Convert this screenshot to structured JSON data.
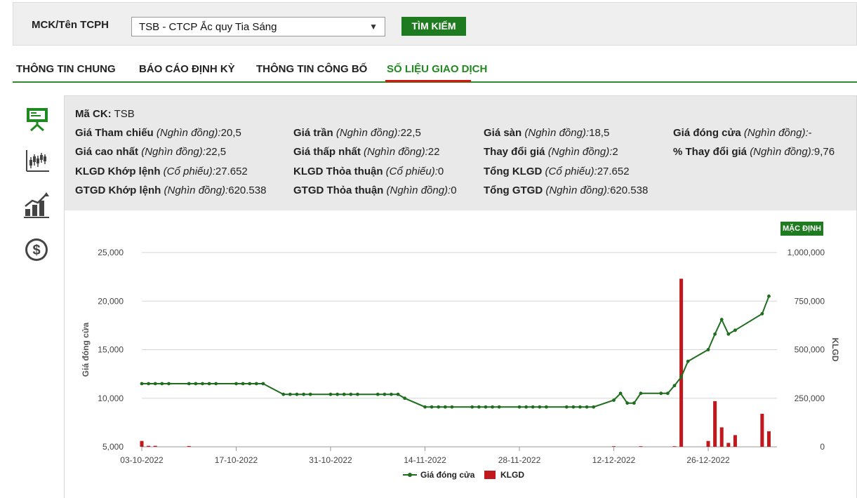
{
  "search": {
    "label": "MCK/Tên TCPH",
    "selected": "TSB - CTCP Ắc quy Tia Sáng",
    "button_label": "TÌM KIẾM"
  },
  "tabs": [
    {
      "label": "THÔNG TIN CHUNG",
      "active": false
    },
    {
      "label": "BÁO CÁO ĐỊNH KỲ",
      "active": false
    },
    {
      "label": "THÔNG TIN CÔNG BỐ",
      "active": false
    },
    {
      "label": "SỐ LIỆU GIAO DỊCH",
      "active": true
    }
  ],
  "side_icons": [
    "presentation-board-icon",
    "candlestick-chart-icon",
    "bar-growth-chart-icon",
    "dollar-coin-icon"
  ],
  "info": {
    "ticker_label": "Mã CK:",
    "ticker": "TSB",
    "rows": [
      [
        {
          "label": "Giá Tham chiếu",
          "unit": "(Nghìn đồng):",
          "value": "20,5"
        },
        {
          "label": "Giá trần",
          "unit": "(Nghìn đồng):",
          "value": "22,5"
        },
        {
          "label": "Giá sàn",
          "unit": "(Nghìn đồng):",
          "value": "18,5"
        },
        {
          "label": "Giá đóng cửa",
          "unit": "(Nghìn đồng):",
          "value": "-"
        }
      ],
      [
        {
          "label": "Giá cao nhất",
          "unit": "(Nghìn đồng):",
          "value": "22,5"
        },
        {
          "label": "Giá thấp nhất",
          "unit": "(Nghìn đồng):",
          "value": "22"
        },
        {
          "label": "Thay đổi giá",
          "unit": "(Nghìn đồng):",
          "value": "2"
        },
        {
          "label": "% Thay đổi giá",
          "unit": "(Nghìn đồng):",
          "value": "9,76"
        }
      ],
      [
        {
          "label": "KLGD Khớp lệnh",
          "unit": "(Cổ phiếu):",
          "value": "27.652"
        },
        {
          "label": "KLGD Thỏa thuận",
          "unit": "(Cổ phiếu):",
          "value": "0"
        },
        {
          "label": "Tổng KLGD",
          "unit": "(Cổ phiếu):",
          "value": "27.652"
        }
      ],
      [
        {
          "label": "GTGD Khớp lệnh",
          "unit": "(Nghìn đồng):",
          "value": "620.538"
        },
        {
          "label": "GTGD Thỏa thuận",
          "unit": "(Nghìn đồng):",
          "value": "0"
        },
        {
          "label": "Tổng GTGD",
          "unit": "(Nghìn đồng):",
          "value": "620.538"
        }
      ]
    ]
  },
  "chart_button": "MẶC ĐỊNH",
  "colors": {
    "line": "#1f6e1f",
    "bar": "#c0181c",
    "accent": "#1f7b1f"
  },
  "chart_data": {
    "type": "line",
    "xlabel": "",
    "ylabel": "Giá đóng cửa",
    "y2label": "KLGD",
    "ylim": [
      5000,
      25000
    ],
    "y2lim": [
      0,
      1000000
    ],
    "y_ticks": [
      "5,000",
      "10,000",
      "15,000",
      "20,000",
      "25,000"
    ],
    "y2_ticks": [
      "0",
      "250,000",
      "500,000",
      "750,000",
      "1,000,000"
    ],
    "x_ticks": [
      "03-10-2022",
      "17-10-2022",
      "31-10-2022",
      "14-11-2022",
      "28-11-2022",
      "12-12-2022",
      "26-12-2022"
    ],
    "legend": [
      "Giá đóng cửa",
      "KLGD"
    ],
    "x": [
      "2022-10-03",
      "2022-10-04",
      "2022-10-05",
      "2022-10-06",
      "2022-10-07",
      "2022-10-10",
      "2022-10-11",
      "2022-10-12",
      "2022-10-13",
      "2022-10-14",
      "2022-10-17",
      "2022-10-18",
      "2022-10-19",
      "2022-10-20",
      "2022-10-21",
      "2022-10-24",
      "2022-10-25",
      "2022-10-26",
      "2022-10-27",
      "2022-10-28",
      "2022-10-31",
      "2022-11-01",
      "2022-11-02",
      "2022-11-03",
      "2022-11-04",
      "2022-11-07",
      "2022-11-08",
      "2022-11-09",
      "2022-11-10",
      "2022-11-11",
      "2022-11-14",
      "2022-11-15",
      "2022-11-16",
      "2022-11-17",
      "2022-11-18",
      "2022-11-21",
      "2022-11-22",
      "2022-11-23",
      "2022-11-24",
      "2022-11-25",
      "2022-11-28",
      "2022-11-29",
      "2022-11-30",
      "2022-12-01",
      "2022-12-02",
      "2022-12-05",
      "2022-12-06",
      "2022-12-07",
      "2022-12-08",
      "2022-12-09",
      "2022-12-12",
      "2022-12-13",
      "2022-12-14",
      "2022-12-15",
      "2022-12-16",
      "2022-12-19",
      "2022-12-20",
      "2022-12-21",
      "2022-12-22",
      "2022-12-23",
      "2022-12-26",
      "2022-12-27",
      "2022-12-28",
      "2022-12-29",
      "2022-12-30",
      "2023-01-03",
      "2023-01-04"
    ],
    "series": [
      {
        "name": "Giá đóng cửa",
        "values": [
          11500,
          11500,
          11500,
          11500,
          11500,
          11500,
          11500,
          11500,
          11500,
          11500,
          11500,
          11500,
          11500,
          11500,
          11500,
          10400,
          10400,
          10400,
          10400,
          10400,
          10400,
          10400,
          10400,
          10400,
          10400,
          10400,
          10400,
          10400,
          10400,
          10000,
          9100,
          9100,
          9100,
          9100,
          9100,
          9100,
          9100,
          9100,
          9100,
          9100,
          9100,
          9100,
          9100,
          9100,
          9100,
          9100,
          9100,
          9100,
          9100,
          9100,
          9800,
          10500,
          9500,
          9500,
          10500,
          10500,
          10500,
          11300,
          12200,
          13800,
          15000,
          16600,
          18100,
          16600,
          17000,
          18700,
          20500
        ]
      },
      {
        "name": "KLGD",
        "values": [
          30000,
          5000,
          5000,
          0,
          0,
          4000,
          0,
          0,
          0,
          0,
          0,
          0,
          0,
          0,
          0,
          0,
          0,
          0,
          0,
          0,
          0,
          0,
          0,
          0,
          0,
          0,
          0,
          0,
          0,
          0,
          0,
          0,
          0,
          0,
          0,
          0,
          0,
          0,
          0,
          0,
          0,
          0,
          0,
          0,
          0,
          0,
          0,
          0,
          0,
          0,
          3000,
          0,
          0,
          0,
          3000,
          0,
          0,
          3000,
          865000,
          0,
          30000,
          235000,
          100000,
          20000,
          60000,
          170000,
          80000
        ]
      }
    ]
  }
}
